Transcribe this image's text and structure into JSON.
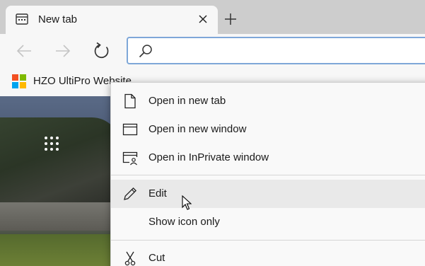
{
  "tab": {
    "title": "New tab"
  },
  "address_bar": {
    "value": ""
  },
  "favorites": [
    {
      "label": "HZO UltiPro Website"
    }
  ],
  "context_menu": {
    "items": [
      {
        "label": "Open in new tab",
        "icon": "page-icon"
      },
      {
        "label": "Open in new window",
        "icon": "window-icon"
      },
      {
        "label": "Open in InPrivate window",
        "icon": "inprivate-window-icon"
      },
      {
        "label": "Edit",
        "icon": "pencil-icon",
        "hovered": true
      },
      {
        "label": "Show icon only",
        "icon": ""
      },
      {
        "label": "Cut",
        "icon": "scissors-icon"
      }
    ]
  },
  "colors": {
    "accent_border": "#7ea7d8",
    "tabstrip": "#cdcdcd",
    "ms_red": "#f25022",
    "ms_green": "#7fba00",
    "ms_blue": "#00a4ef",
    "ms_yellow": "#ffb900"
  }
}
